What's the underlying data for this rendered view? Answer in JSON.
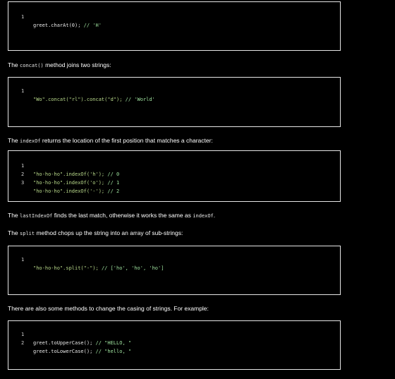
{
  "blocks": [
    {
      "lines": [
        {
          "num": "1",
          "code": "greet.charAt(0);",
          "comment": "// 'H'"
        }
      ]
    },
    {
      "lines": [
        {
          "num": "1",
          "code": "\"Wo\".concat(\"rl\").concat(\"d\");",
          "comment": "// 'World'"
        }
      ]
    },
    {
      "lines": [
        {
          "num": "1",
          "code": "\"ho-ho-ho\".indexOf('h');",
          "comment": "// 0"
        },
        {
          "num": "2",
          "code": "\"ho-ho-ho\".indexOf('o');",
          "comment": "// 1"
        },
        {
          "num": "3",
          "code": "\"ho-ho-ho\".indexOf('-');",
          "comment": "// 2"
        }
      ]
    },
    {
      "lines": [
        {
          "num": "1",
          "code": "\"ho-ho-ho\".split(\"-\");",
          "comment": "// ['ho', 'ho', 'ho']"
        }
      ]
    },
    {
      "lines": [
        {
          "num": "1",
          "code": "greet.toUpperCase();",
          "comment": "// \"HELLO, \""
        },
        {
          "num": "2",
          "code": "greet.toLowerCase();",
          "comment": "// \"hello, \""
        }
      ]
    }
  ],
  "paragraphs": {
    "concat": {
      "pre": "The ",
      "code": "concat()",
      "post": " method joins two strings:"
    },
    "indexof": {
      "pre": "The ",
      "code": "indexOf",
      "post": " returns the location of the first position that matches a character:"
    },
    "lastindexof": {
      "pre": "The ",
      "code": "lastIndexOf",
      "mid": " finds the last match, otherwise it works the same as ",
      "code2": "indexOf",
      "post": "."
    },
    "split": {
      "pre": "The ",
      "code": "split",
      "post": " method chops up the string into an array of sub-strings:"
    },
    "casing": {
      "text": "There are also some methods to change the casing of strings. For example:"
    }
  },
  "colors": {
    "background": "#000000",
    "border": "#e6e6e6",
    "comment": "#9fe39f",
    "text": "#ffffff"
  }
}
